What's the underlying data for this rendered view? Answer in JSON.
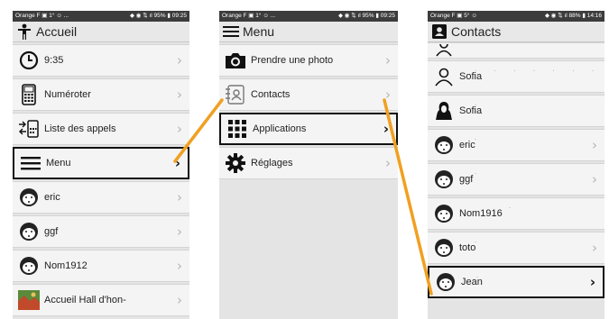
{
  "colors": {
    "connector": "#f0a020",
    "selected_border": "#111111",
    "status_bg": "#3c3c3c",
    "row_bg": "#f4f4f4"
  },
  "screens": [
    {
      "status": {
        "left": "Orange F ▣ 1° ☺ ...",
        "right": "◆ ◉ ⇅ ıl 95% ▮ 09:25"
      },
      "title": "Accueil",
      "title_icon": "person-icon",
      "items": [
        {
          "label": "9:35",
          "icon": "clock-icon"
        },
        {
          "label": "Numéroter",
          "icon": "phone-keypad-icon"
        },
        {
          "label": "Liste des appels",
          "icon": "call-log-icon"
        },
        {
          "label": "Menu",
          "icon": "hamburger-icon",
          "selected": true
        },
        {
          "label": "eric",
          "icon": "contact-face-icon"
        },
        {
          "label": "ggf",
          "icon": "contact-face-icon"
        },
        {
          "label": "Nom1912",
          "icon": "contact-face-icon"
        },
        {
          "label": "Accueil Hall d'hon-",
          "icon": "photo-thumbnail-icon"
        }
      ]
    },
    {
      "status": {
        "left": "Orange F ▣ 1° ☺ ...",
        "right": "◆ ◉ ⇅ ıl 95% ▮ 09:25"
      },
      "title": "Menu",
      "title_icon": "hamburger-icon",
      "items": [
        {
          "label": "Prendre une photo",
          "icon": "camera-icon"
        },
        {
          "label": "Contacts",
          "icon": "contacts-book-icon"
        },
        {
          "label": "Applications",
          "icon": "apps-grid-icon",
          "selected": true
        },
        {
          "label": "Réglages",
          "icon": "gear-icon"
        }
      ]
    },
    {
      "status": {
        "left": "Orange F ▣ 5° ☺",
        "right": "◆ ◉ ⇅ ıl 88% ▮ 14:16"
      },
      "title": "Contacts",
      "title_icon": "contact-card-icon",
      "items": [
        {
          "label": "Sofia",
          "icon": "person-outline-icon"
        },
        {
          "label": "Sofia",
          "icon": "person-silhouette-icon"
        },
        {
          "label": "eric",
          "icon": "contact-face-icon"
        },
        {
          "label": "ggf",
          "icon": "contact-face-icon"
        },
        {
          "label": "Nom1916",
          "icon": "contact-face-icon"
        },
        {
          "label": "toto",
          "icon": "contact-face-icon"
        },
        {
          "label": "Jean",
          "icon": "contact-face-icon",
          "selected": true
        }
      ]
    }
  ],
  "chevron_glyph": "›"
}
